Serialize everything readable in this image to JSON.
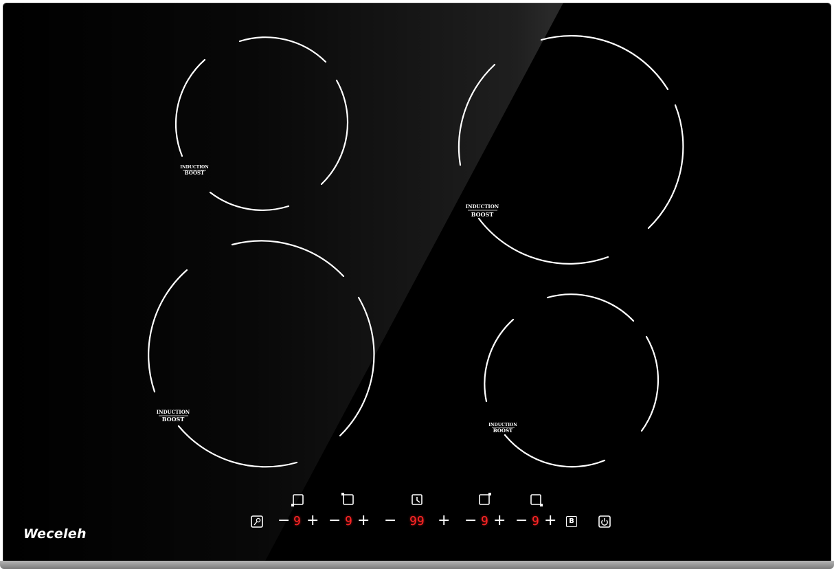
{
  "brand": "Weceleh",
  "zones": [
    {
      "name": "rear-left",
      "label_top": "INDUCTION",
      "label_bottom": "BOOST"
    },
    {
      "name": "front-left",
      "label_top": "INDUCTION",
      "label_bottom": "BOOST"
    },
    {
      "name": "rear-right",
      "label_top": "INDUCTION",
      "label_bottom": "BOOST"
    },
    {
      "name": "front-right",
      "label_top": "INDUCTION",
      "label_bottom": "BOOST"
    }
  ],
  "controls": {
    "minus": "−",
    "plus": "+",
    "zone1_level": "9",
    "zone2_level": "9",
    "timer_value": "99",
    "zone3_level": "9",
    "zone4_level": "9",
    "boost_label": "B"
  },
  "icons": {
    "lock": "lock-icon",
    "timer": "clock-icon",
    "power": "power-icon"
  },
  "colors": {
    "glass": "#000000",
    "display": "#ff2626",
    "ring": "#ffffff"
  }
}
